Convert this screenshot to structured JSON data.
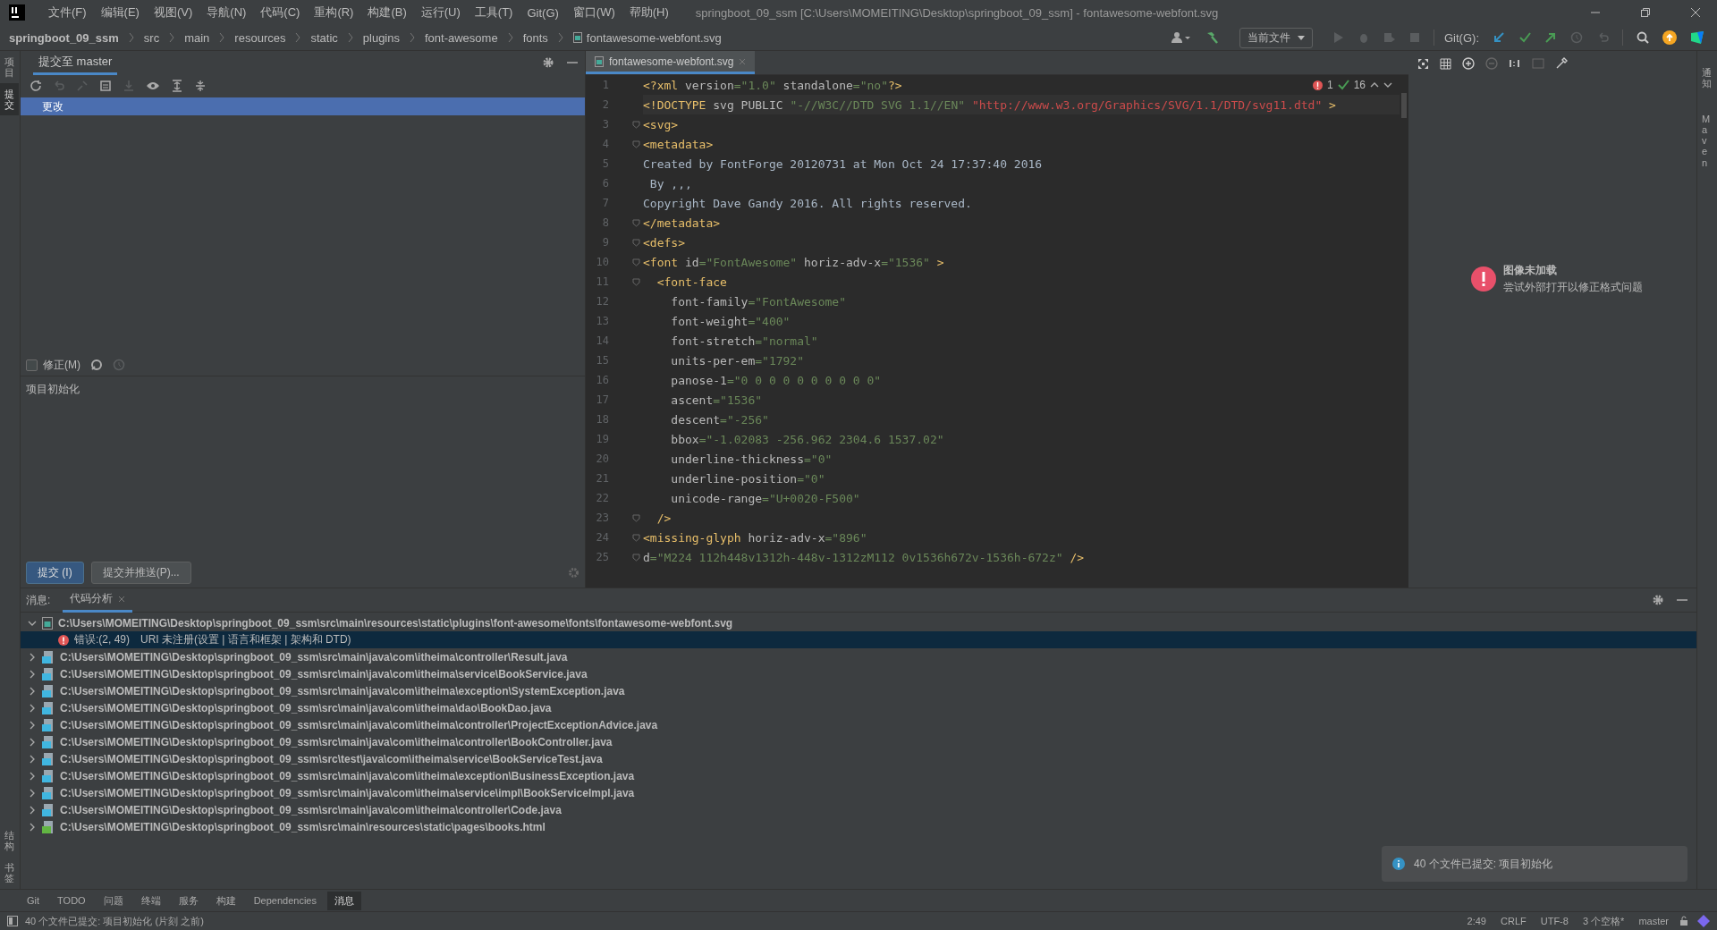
{
  "menu": [
    "文件(F)",
    "编辑(E)",
    "视图(V)",
    "导航(N)",
    "代码(C)",
    "重构(R)",
    "构建(B)",
    "运行(U)",
    "工具(T)",
    "Git(G)",
    "窗口(W)",
    "帮助(H)"
  ],
  "window": {
    "title": "springboot_09_ssm [C:\\Users\\MOMEITING\\Desktop\\springboot_09_ssm] - fontawesome-webfont.svg"
  },
  "breadcrumbs": [
    {
      "label": "springboot_09_ssm",
      "kind": "project"
    },
    {
      "label": "src",
      "kind": "dir"
    },
    {
      "label": "main",
      "kind": "dir"
    },
    {
      "label": "resources",
      "kind": "dir"
    },
    {
      "label": "static",
      "kind": "dir"
    },
    {
      "label": "plugins",
      "kind": "dir"
    },
    {
      "label": "font-awesome",
      "kind": "dir"
    },
    {
      "label": "fonts",
      "kind": "dir"
    },
    {
      "label": "fontawesome-webfont.svg",
      "kind": "file"
    }
  ],
  "toolbar": {
    "run_config": "当前文件",
    "git_label": "Git(G):"
  },
  "left_strip": {
    "top": [
      {
        "label": "项目",
        "selected": false
      },
      {
        "label": "提交",
        "selected": true
      }
    ],
    "bottom": [
      {
        "label": "结构"
      },
      {
        "label": "书签"
      }
    ]
  },
  "right_strip": [
    {
      "label": "通知"
    },
    {
      "label": "Maven"
    }
  ],
  "commit_panel": {
    "tab": "提交至 master",
    "changes": {
      "label": "更改",
      "selected": true
    },
    "amend": {
      "label": "修正(M)",
      "checked": false
    },
    "message": "项目初始化",
    "buttons": [
      {
        "label": "提交 (I)",
        "primary": true
      },
      {
        "label": "提交并推送(P)...",
        "primary": false
      }
    ]
  },
  "editor": {
    "tab": "fontawesome-webfont.svg",
    "errors": "1",
    "warnings": "16",
    "lines": [
      {
        "n": "1",
        "fold": false,
        "current": false,
        "tokens": [
          {
            "kind": "tag",
            "t": "<?xml "
          },
          {
            "kind": "attr",
            "t": "version"
          },
          {
            "kind": "str",
            "t": "=\"1.0\" "
          },
          {
            "kind": "attr",
            "t": "standalone"
          },
          {
            "kind": "str",
            "t": "=\"no\""
          },
          {
            "kind": "tag",
            "t": "?>"
          }
        ]
      },
      {
        "n": "2",
        "fold": false,
        "current": true,
        "tokens": [
          {
            "kind": "tag",
            "t": "<!DOCTYPE "
          },
          {
            "kind": "attr",
            "t": "svg PUBLIC "
          },
          {
            "kind": "str",
            "t": "\"-//W3C//DTD SVG 1.1//EN\" "
          },
          {
            "kind": "url",
            "t": "\"http://www.w3.org/Graphics/SVG/1.1/DTD/svg11.dtd\""
          },
          {
            "kind": "tag",
            "t": " >"
          }
        ]
      },
      {
        "n": "3",
        "fold": true,
        "current": false,
        "tokens": [
          {
            "kind": "tag",
            "t": "<svg>"
          }
        ]
      },
      {
        "n": "4",
        "fold": true,
        "current": false,
        "tokens": [
          {
            "kind": "tag",
            "t": "<metadata>"
          }
        ]
      },
      {
        "n": "5",
        "fold": false,
        "current": false,
        "tokens": [
          {
            "kind": "text",
            "t": "Created by FontForge 20120731 at Mon Oct 24 17:37:40 2016"
          }
        ]
      },
      {
        "n": "6",
        "fold": false,
        "current": false,
        "tokens": [
          {
            "kind": "text",
            "t": " By ,,,"
          }
        ]
      },
      {
        "n": "7",
        "fold": false,
        "current": false,
        "tokens": [
          {
            "kind": "text",
            "t": "Copyright Dave Gandy 2016. All rights reserved."
          }
        ]
      },
      {
        "n": "8",
        "fold": true,
        "current": false,
        "tokens": [
          {
            "kind": "tag",
            "t": "</metadata>"
          }
        ]
      },
      {
        "n": "9",
        "fold": true,
        "current": false,
        "tokens": [
          {
            "kind": "tag",
            "t": "<defs>"
          }
        ]
      },
      {
        "n": "10",
        "fold": true,
        "current": false,
        "tokens": [
          {
            "kind": "tag",
            "t": "<font "
          },
          {
            "kind": "attr",
            "t": "id"
          },
          {
            "kind": "str",
            "t": "=\"FontAwesome\" "
          },
          {
            "kind": "attr",
            "t": "horiz-adv-x"
          },
          {
            "kind": "str",
            "t": "=\"1536\" "
          },
          {
            "kind": "tag",
            "t": ">"
          }
        ]
      },
      {
        "n": "11",
        "fold": true,
        "current": false,
        "tokens": [
          {
            "kind": "tag",
            "t": "  <font-face"
          }
        ]
      },
      {
        "n": "12",
        "fold": false,
        "current": false,
        "tokens": [
          {
            "kind": "attr",
            "t": "    font-family"
          },
          {
            "kind": "str",
            "t": "=\"FontAwesome\""
          }
        ]
      },
      {
        "n": "13",
        "fold": false,
        "current": false,
        "tokens": [
          {
            "kind": "attr",
            "t": "    font-weight"
          },
          {
            "kind": "str",
            "t": "=\"400\""
          }
        ]
      },
      {
        "n": "14",
        "fold": false,
        "current": false,
        "tokens": [
          {
            "kind": "attr",
            "t": "    font-stretch"
          },
          {
            "kind": "str",
            "t": "=\"normal\""
          }
        ]
      },
      {
        "n": "15",
        "fold": false,
        "current": false,
        "tokens": [
          {
            "kind": "attr",
            "t": "    units-per-em"
          },
          {
            "kind": "str",
            "t": "=\"1792\""
          }
        ]
      },
      {
        "n": "16",
        "fold": false,
        "current": false,
        "tokens": [
          {
            "kind": "attr",
            "t": "    panose-1"
          },
          {
            "kind": "str",
            "t": "=\"0 0 0 0 0 0 0 0 0 0\""
          }
        ]
      },
      {
        "n": "17",
        "fold": false,
        "current": false,
        "tokens": [
          {
            "kind": "attr",
            "t": "    ascent"
          },
          {
            "kind": "str",
            "t": "=\"1536\""
          }
        ]
      },
      {
        "n": "18",
        "fold": false,
        "current": false,
        "tokens": [
          {
            "kind": "attr",
            "t": "    descent"
          },
          {
            "kind": "str",
            "t": "=\"-256\""
          }
        ]
      },
      {
        "n": "19",
        "fold": false,
        "current": false,
        "tokens": [
          {
            "kind": "attr",
            "t": "    bbox"
          },
          {
            "kind": "str",
            "t": "=\"-1.02083 -256.962 2304.6 1537.02\""
          }
        ]
      },
      {
        "n": "20",
        "fold": false,
        "current": false,
        "tokens": [
          {
            "kind": "attr",
            "t": "    underline-thickness"
          },
          {
            "kind": "str",
            "t": "=\"0\""
          }
        ]
      },
      {
        "n": "21",
        "fold": false,
        "current": false,
        "tokens": [
          {
            "kind": "attr",
            "t": "    underline-position"
          },
          {
            "kind": "str",
            "t": "=\"0\""
          }
        ]
      },
      {
        "n": "22",
        "fold": false,
        "current": false,
        "tokens": [
          {
            "kind": "attr",
            "t": "    unicode-range"
          },
          {
            "kind": "str",
            "t": "=\"U+0020-F500\""
          }
        ]
      },
      {
        "n": "23",
        "fold": true,
        "current": false,
        "tokens": [
          {
            "kind": "tag",
            "t": "  />"
          }
        ]
      },
      {
        "n": "24",
        "fold": true,
        "current": false,
        "tokens": [
          {
            "kind": "tag",
            "t": "<missing-glyph "
          },
          {
            "kind": "attr",
            "t": "horiz-adv-x"
          },
          {
            "kind": "str",
            "t": "=\"896\""
          }
        ]
      },
      {
        "n": "25",
        "fold": true,
        "current": false,
        "tokens": [
          {
            "kind": "attr",
            "t": "d"
          },
          {
            "kind": "str",
            "t": "=\"M224 112h448v1312h-448v-1312zM112 0v1536h672v-1536h-672z\" "
          },
          {
            "kind": "tag",
            "t": "/>"
          }
        ]
      }
    ]
  },
  "preview": {
    "title": "图像未加载",
    "hint": "尝试外部打开以修正格式问题"
  },
  "messages": {
    "label": "消息:",
    "tab": "代码分析",
    "tree": [
      {
        "path": "C:\\Users\\MOMEITING\\Desktop\\springboot_09_ssm\\src\\main\\resources\\static\\plugins\\font-awesome\\fonts\\fontawesome-webfont.svg",
        "kind": "svg",
        "expanded": true,
        "children": [
          {
            "location": "错误:(2, 49)",
            "text": "URI 未注册(设置 | 语言和框架 | 架构和 DTD)",
            "selected": true
          }
        ]
      },
      {
        "path": "C:\\Users\\MOMEITING\\Desktop\\springboot_09_ssm\\src\\main\\java\\com\\itheima\\controller\\Result.java",
        "kind": "java",
        "expanded": false
      },
      {
        "path": "C:\\Users\\MOMEITING\\Desktop\\springboot_09_ssm\\src\\main\\java\\com\\itheima\\service\\BookService.java",
        "kind": "java",
        "expanded": false
      },
      {
        "path": "C:\\Users\\MOMEITING\\Desktop\\springboot_09_ssm\\src\\main\\java\\com\\itheima\\exception\\SystemException.java",
        "kind": "java",
        "expanded": false
      },
      {
        "path": "C:\\Users\\MOMEITING\\Desktop\\springboot_09_ssm\\src\\main\\java\\com\\itheima\\dao\\BookDao.java",
        "kind": "java",
        "expanded": false
      },
      {
        "path": "C:\\Users\\MOMEITING\\Desktop\\springboot_09_ssm\\src\\main\\java\\com\\itheima\\controller\\ProjectExceptionAdvice.java",
        "kind": "java",
        "expanded": false
      },
      {
        "path": "C:\\Users\\MOMEITING\\Desktop\\springboot_09_ssm\\src\\main\\java\\com\\itheima\\controller\\BookController.java",
        "kind": "java",
        "expanded": false
      },
      {
        "path": "C:\\Users\\MOMEITING\\Desktop\\springboot_09_ssm\\src\\test\\java\\com\\itheima\\service\\BookServiceTest.java",
        "kind": "java",
        "expanded": false
      },
      {
        "path": "C:\\Users\\MOMEITING\\Desktop\\springboot_09_ssm\\src\\main\\java\\com\\itheima\\exception\\BusinessException.java",
        "kind": "java",
        "expanded": false
      },
      {
        "path": "C:\\Users\\MOMEITING\\Desktop\\springboot_09_ssm\\src\\main\\java\\com\\itheima\\service\\impl\\BookServiceImpl.java",
        "kind": "java",
        "expanded": false
      },
      {
        "path": "C:\\Users\\MOMEITING\\Desktop\\springboot_09_ssm\\src\\main\\java\\com\\itheima\\controller\\Code.java",
        "kind": "java",
        "expanded": false
      },
      {
        "path": "C:\\Users\\MOMEITING\\Desktop\\springboot_09_ssm\\src\\main\\resources\\static\\pages\\books.html",
        "kind": "html",
        "expanded": false
      }
    ]
  },
  "notification": {
    "text": "40 个文件已提交: 项目初始化"
  },
  "tool_windows": [
    {
      "label": "Git",
      "selected": false
    },
    {
      "label": "TODO",
      "selected": false
    },
    {
      "label": "问题",
      "selected": false
    },
    {
      "label": "终端",
      "selected": false
    },
    {
      "label": "服务",
      "selected": false
    },
    {
      "label": "构建",
      "selected": false
    },
    {
      "label": "Dependencies",
      "selected": false
    },
    {
      "label": "消息",
      "selected": true
    }
  ],
  "status_bar": {
    "message": "40 个文件已提交: 项目初始化 (片刻 之前)",
    "items": [
      "2:49",
      "CRLF",
      "UTF-8",
      "3 个空格*"
    ],
    "branch": "master"
  }
}
